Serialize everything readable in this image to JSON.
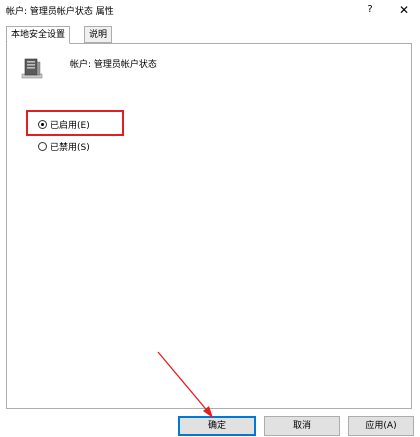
{
  "window": {
    "title": "帐户: 管理员帐户状态 属性",
    "help_glyph": "?",
    "close_glyph": "✕"
  },
  "tabs": [
    {
      "label": "本地安全设置",
      "active": true
    },
    {
      "label": "说明",
      "active": false
    }
  ],
  "account": {
    "label": "帐户: 管理员帐户状态",
    "icon": "server-icon"
  },
  "options": {
    "enabled_label": "已启用(E)",
    "disabled_label": "已禁用(S)",
    "selected": "enabled"
  },
  "buttons": {
    "ok_label": "确定",
    "cancel_label": "取消",
    "apply_label": "应用(A)"
  },
  "colors": {
    "highlight": "#e02020",
    "primary_border": "#0078d7"
  }
}
